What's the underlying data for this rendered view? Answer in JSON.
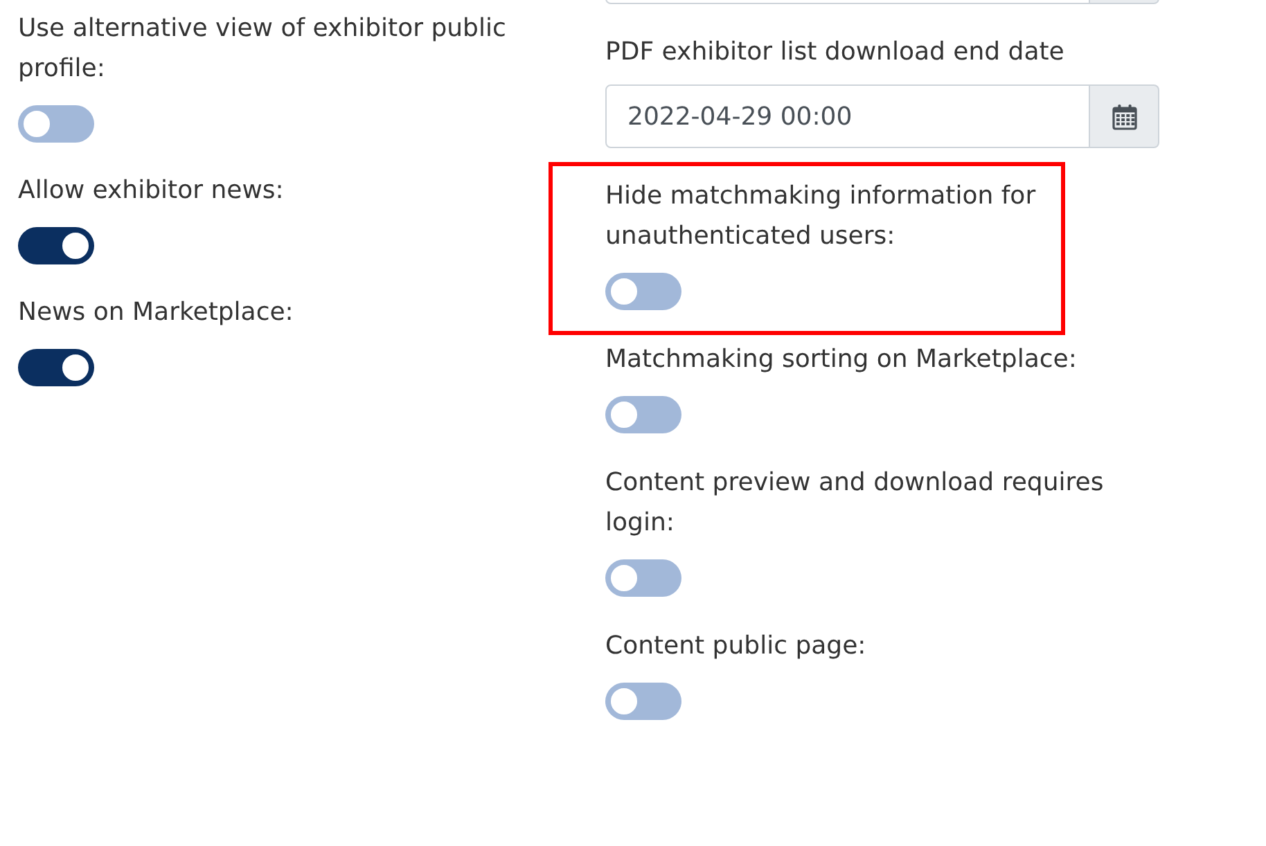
{
  "left_settings": [
    {
      "label": "Use alternative view of exhibitor public profile:",
      "on": false
    },
    {
      "label": "Allow exhibitor news:",
      "on": true
    },
    {
      "label": "News on Marketplace:",
      "on": true
    }
  ],
  "date_field": {
    "label": "PDF exhibitor list download end date",
    "value": "2022-04-29 00:00"
  },
  "right_settings": [
    {
      "label": "Hide matchmaking information for unauthenticated users:",
      "on": false,
      "highlighted": true
    },
    {
      "label": "Matchmaking sorting on Marketplace:",
      "on": false,
      "highlighted": false
    },
    {
      "label": "Content preview and download requires login:",
      "on": false,
      "highlighted": false
    },
    {
      "label": "Content public page:",
      "on": false,
      "highlighted": false
    }
  ]
}
